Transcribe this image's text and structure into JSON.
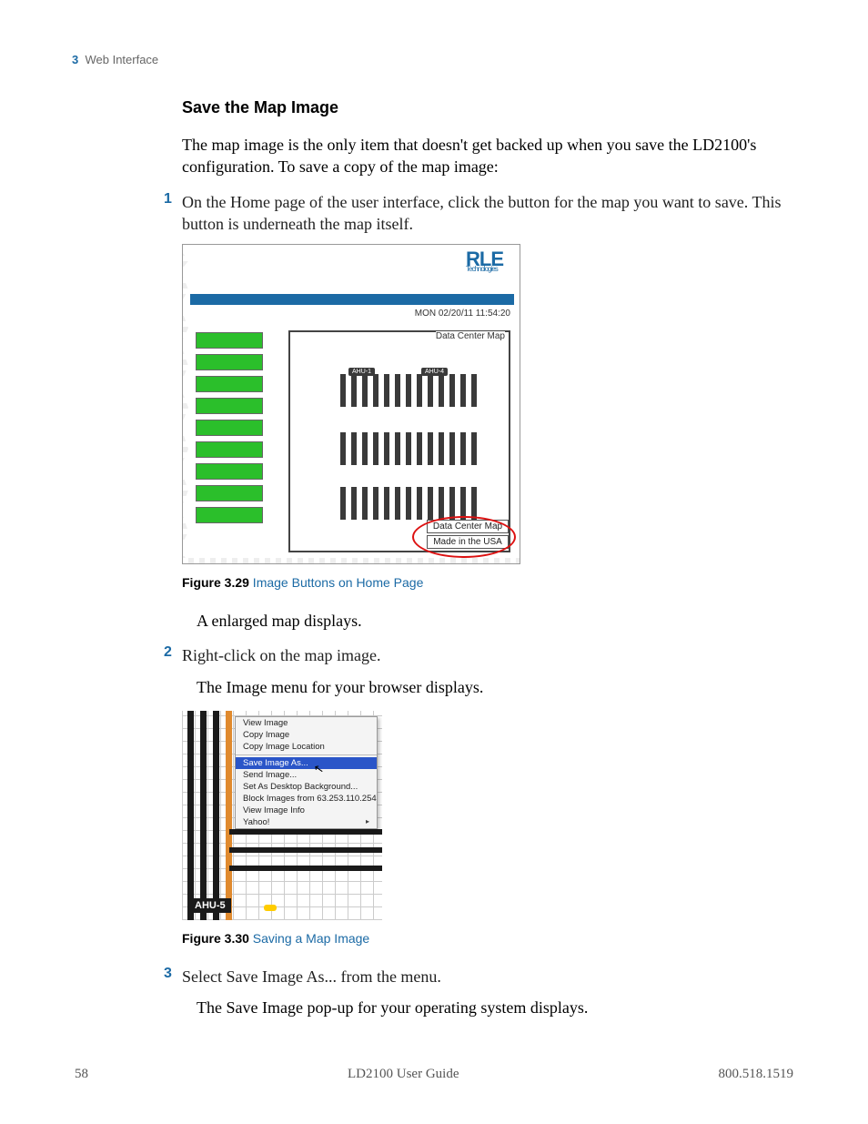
{
  "running_head": {
    "chapter_num": "3",
    "chapter_title": "Web Interface"
  },
  "section_title": "Save the Map Image",
  "intro": "The map image is the only item that doesn't get backed up when you save the LD2100's configuration. To save a copy of the map image:",
  "step1": {
    "num": "1",
    "text": "On the Home page of the user interface, click the button for the map you want to save. This button is underneath the map itself."
  },
  "fig329": {
    "caption_label": "Figure 3.29",
    "caption_title": " Image Buttons on Home Page",
    "logo_top": "RLE",
    "logo_sub": "Technologies",
    "timestamp": "MON 02/20/11 11:54:20",
    "map_title": "Data Center Map",
    "ahu_a": "AHU-1",
    "ahu_b": "AHU-4",
    "btn_map": "Data Center Map",
    "btn_made": "Made in the USA"
  },
  "after_fig1": "A enlarged map displays.",
  "step2": {
    "num": "2",
    "text": "Right-click on the map image."
  },
  "after_step2": "The Image menu for your browser displays.",
  "fig330": {
    "caption_label": "Figure 3.30",
    "caption_title": " Saving a Map Image",
    "menu": {
      "view": "View Image",
      "copy": "Copy Image",
      "copyloc": "Copy Image Location",
      "saveas": "Save Image As...",
      "send": "Send Image...",
      "setbg": "Set As Desktop Background...",
      "block": "Block Images from 63.253.110.254",
      "info": "View Image Info",
      "yahoo": "Yahoo!"
    },
    "ahu5": "AHU-5"
  },
  "step3": {
    "num": "3",
    "text": "Select Save Image As... from the menu."
  },
  "after_step3": "The Save Image pop-up for your operating system displays.",
  "footer": {
    "page": "58",
    "guide": "LD2100 User Guide",
    "phone": "800.518.1519"
  }
}
